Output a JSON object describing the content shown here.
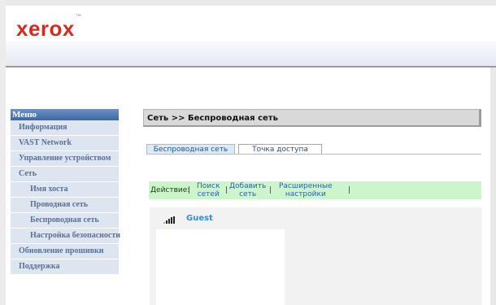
{
  "brand": {
    "logo_text": "xerox",
    "logo_mark": "™",
    "color": "#d52b1e"
  },
  "sidebar": {
    "header": "Меню",
    "items": [
      {
        "label": "Информация",
        "sub": false
      },
      {
        "label": "VAST Network",
        "sub": false
      },
      {
        "label": "Управление устройством",
        "sub": false
      },
      {
        "label": "Сеть",
        "sub": false
      },
      {
        "label": "Имя хоста",
        "sub": true
      },
      {
        "label": "Проводная сеть",
        "sub": true
      },
      {
        "label": "Беспроводная сеть",
        "sub": true
      },
      {
        "label": "Настройка безопасности",
        "sub": true
      },
      {
        "label": "Обновление прошивки",
        "sub": false
      },
      {
        "label": "Поддержка",
        "sub": false
      }
    ]
  },
  "main": {
    "breadcrumb": "Сеть >> Беспроводная сеть",
    "tabs": [
      {
        "label": "Беспроводная сеть",
        "active": true
      },
      {
        "label": "Точка доступа",
        "active": false
      }
    ],
    "actions": {
      "label": "Действие:",
      "separator": "|",
      "links": [
        {
          "line1": "Поиск",
          "line2": "сетей"
        },
        {
          "line1": "Добавить",
          "line2": "сеть"
        },
        {
          "line1": "Расширенные",
          "line2": "настройки"
        }
      ]
    },
    "network": {
      "ssid": "Guest",
      "icon": "signal-bars-icon"
    }
  }
}
